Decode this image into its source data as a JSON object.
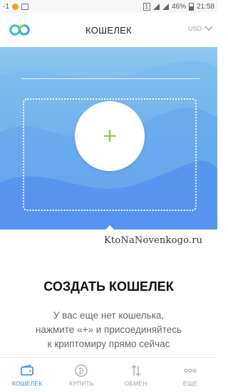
{
  "statusbar": {
    "signal_text": "-1",
    "sim_badge": "1",
    "battery": "46%",
    "time": "21:58"
  },
  "header": {
    "title": "КОШЕЛЕК",
    "currency": "USD"
  },
  "hero": {
    "add_symbol": "+"
  },
  "watermark": "KtoNaNovenkogo.ru",
  "main": {
    "heading": "СОЗДАТЬ КОШЕЛЕК",
    "description_lines": [
      "У вас еще нет кошелька,",
      "нажмите «+» и присоединяйтесь",
      "к криптомиру прямо сейчас"
    ]
  },
  "bottomnav": {
    "items": [
      {
        "label": "КОШЕЛЕК",
        "icon": "wallet-icon",
        "active": true
      },
      {
        "label": "КУПИТЬ",
        "icon": "bitcoin-icon",
        "active": false
      },
      {
        "label": "ОБМЕН",
        "icon": "exchange-arrows-icon",
        "active": false
      },
      {
        "label": "ЕЩЕ",
        "icon": "more-dots-icon",
        "active": false
      }
    ]
  },
  "colors": {
    "accent": "#2f8fe6",
    "plus": "#9ccc45",
    "hero_top": "#8fc8ef",
    "hero_bottom": "#4f8ff0"
  }
}
